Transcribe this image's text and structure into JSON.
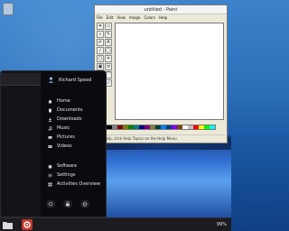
{
  "paint": {
    "title": "untitled - Paint",
    "menu": [
      "File",
      "Edit",
      "View",
      "Image",
      "Colors",
      "Help"
    ],
    "tools": [
      "✦",
      "▭",
      "⌕",
      "✎",
      "✐",
      "A",
      "/",
      "◯",
      "▢",
      "✶",
      "▣",
      "⬭",
      "⬚",
      "⌒",
      "⌇",
      "▱"
    ],
    "palette": [
      "#000000",
      "#808080",
      "#800000",
      "#808000",
      "#008000",
      "#008080",
      "#000080",
      "#800080",
      "#808040",
      "#004040",
      "#0080ff",
      "#004080",
      "#8000ff",
      "#804000",
      "#ffffff",
      "#c0c0c0",
      "#ff0000",
      "#ffff00",
      "#00ff00",
      "#00ffff"
    ],
    "status": "For Help, click Help Topics on the Help Menu."
  },
  "menu": {
    "user_name": "Richard Speed",
    "items": [
      {
        "label": "Home",
        "icon": "home-icon"
      },
      {
        "label": "Documents",
        "icon": "documents-icon"
      },
      {
        "label": "Downloads",
        "icon": "downloads-icon"
      },
      {
        "label": "Music",
        "icon": "music-icon"
      },
      {
        "label": "Pictures",
        "icon": "pictures-icon"
      },
      {
        "label": "Videos",
        "icon": "videos-icon"
      }
    ],
    "items2": [
      {
        "label": "Software",
        "icon": "software-icon"
      },
      {
        "label": "Settings",
        "icon": "settings-icon"
      },
      {
        "label": "Activities Overview",
        "icon": "activities-icon"
      }
    ]
  },
  "taskbar": {
    "battery": "99%"
  },
  "colors": {
    "accent": "#4a90e2",
    "menu_bg": "#0b0b0f",
    "taskbar_bg": "#1b1b20",
    "app_red": "#c0392b"
  }
}
